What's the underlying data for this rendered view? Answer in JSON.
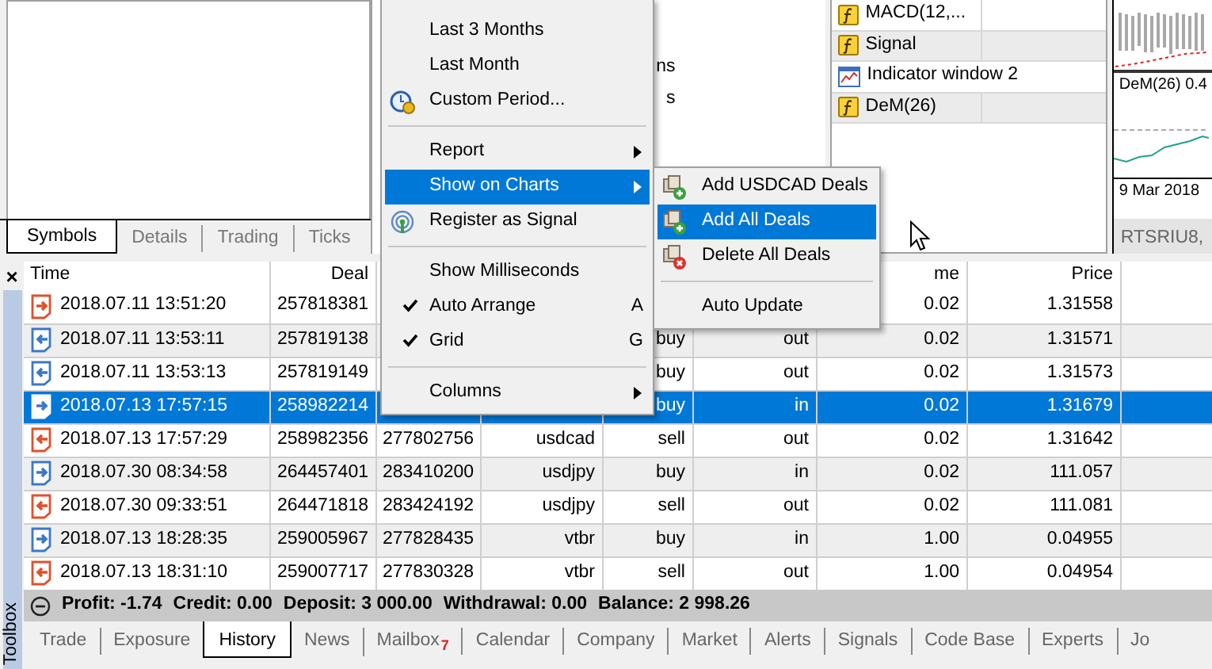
{
  "navigator": {
    "tabs": [
      {
        "label": "Symbols",
        "selected": true
      },
      {
        "label": "Details",
        "selected": false
      },
      {
        "label": "Trading",
        "selected": false
      },
      {
        "label": "Ticks",
        "selected": false
      }
    ]
  },
  "middle_panel": {
    "fragments": [
      "ns",
      "s"
    ]
  },
  "data_window": {
    "rows": [
      {
        "label": "MACD(12,...",
        "kind": "function"
      },
      {
        "label": "Signal",
        "kind": "function"
      },
      {
        "label": "Indicator window 2",
        "kind": "window"
      },
      {
        "label": "DeM(26)",
        "kind": "function"
      }
    ]
  },
  "chart": {
    "subwindow_label": "DeM(26) 0.4",
    "date_label": "9 Mar 2018",
    "tab": "RTSRIU8,"
  },
  "toolbox": {
    "title": "Toolbox",
    "close": "×",
    "columns": [
      "Time",
      "Deal",
      null,
      null,
      null,
      null,
      "me",
      "Price",
      null
    ],
    "rows": [
      {
        "kind": "sell_in",
        "selected": false,
        "cells": [
          "2018.07.11 13:51:20",
          "257818381",
          null,
          null,
          null,
          null,
          "0.02",
          "1.31558"
        ]
      },
      {
        "kind": "buy_out",
        "selected": false,
        "cells": [
          "2018.07.11 13:53:11",
          "257819138",
          null,
          null,
          "buy",
          "out",
          "0.02",
          "1.31571"
        ]
      },
      {
        "kind": "buy_out",
        "selected": false,
        "cells": [
          "2018.07.11 13:53:13",
          "257819149",
          null,
          null,
          "buy",
          "out",
          "0.02",
          "1.31573"
        ]
      },
      {
        "kind": "buy_in",
        "selected": true,
        "cells": [
          "2018.07.13 17:57:15",
          "258982214",
          null,
          null,
          "buy",
          "in",
          "0.02",
          "1.31679"
        ]
      },
      {
        "kind": "sell_out",
        "selected": false,
        "cells": [
          "2018.07.13 17:57:29",
          "258982356",
          "277802756",
          "usdcad",
          "sell",
          "out",
          "0.02",
          "1.31642"
        ]
      },
      {
        "kind": "buy_in",
        "selected": false,
        "cells": [
          "2018.07.30 08:34:58",
          "264457401",
          "283410200",
          "usdjpy",
          "buy",
          "in",
          "0.02",
          "111.057"
        ]
      },
      {
        "kind": "sell_out",
        "selected": false,
        "cells": [
          "2018.07.30 09:33:51",
          "264471818",
          "283424192",
          "usdjpy",
          "sell",
          "out",
          "0.02",
          "111.081"
        ]
      },
      {
        "kind": "buy_in",
        "selected": false,
        "cells": [
          "2018.07.13 18:28:35",
          "259005967",
          "277828435",
          "vtbr",
          "buy",
          "in",
          "1.00",
          "0.04955"
        ]
      },
      {
        "kind": "sell_out",
        "selected": false,
        "cells": [
          "2018.07.13 18:31:10",
          "259007717",
          "277830328",
          "vtbr",
          "sell",
          "out",
          "1.00",
          "0.04954"
        ]
      }
    ],
    "summary": [
      "Profit: -1.74",
      "Credit: 0.00",
      "Deposit: 3 000.00",
      "Withdrawal: 0.00",
      "Balance: 2 998.26"
    ],
    "tabs": [
      {
        "label": "Trade",
        "selected": false
      },
      {
        "label": "Exposure",
        "selected": false
      },
      {
        "label": "History",
        "selected": true
      },
      {
        "label": "News",
        "selected": false
      },
      {
        "label": "Mailbox",
        "selected": false,
        "badge": "7"
      },
      {
        "label": "Calendar",
        "selected": false
      },
      {
        "label": "Company",
        "selected": false
      },
      {
        "label": "Market",
        "selected": false
      },
      {
        "label": "Alerts",
        "selected": false
      },
      {
        "label": "Signals",
        "selected": false
      },
      {
        "label": "Code Base",
        "selected": false
      },
      {
        "label": "Experts",
        "selected": false
      },
      {
        "label": "Jo",
        "selected": false
      }
    ]
  },
  "context_menu": {
    "items": [
      {
        "kind": "item",
        "label": "Last 3 Months",
        "selected": false
      },
      {
        "kind": "item",
        "label": "Last Month",
        "selected": false
      },
      {
        "kind": "clock_item",
        "label": "Custom Period...",
        "selected": false
      },
      {
        "kind": "separator"
      },
      {
        "kind": "item",
        "label": "Report",
        "selected": false,
        "has_submenu": true
      },
      {
        "kind": "item",
        "label": "Show on Charts",
        "selected": true,
        "has_submenu": true
      },
      {
        "kind": "signal_item",
        "label": "Register as Signal",
        "selected": false
      },
      {
        "kind": "separator"
      },
      {
        "kind": "item",
        "label": "Show Milliseconds",
        "selected": false,
        "checked": false
      },
      {
        "kind": "item",
        "label": "Auto Arrange",
        "selected": false,
        "checked": true,
        "shortcut": "A"
      },
      {
        "kind": "item",
        "label": "Grid",
        "selected": false,
        "checked": true,
        "shortcut": "G"
      },
      {
        "kind": "separator"
      },
      {
        "kind": "item",
        "label": "Columns",
        "selected": false,
        "has_submenu": true
      }
    ]
  },
  "submenu": {
    "items": [
      {
        "kind": "add_item",
        "label": "Add USDCAD Deals",
        "selected": false
      },
      {
        "kind": "add_item",
        "label": "Add All Deals",
        "selected": true
      },
      {
        "kind": "delete_item",
        "label": "Delete All Deals",
        "selected": false
      },
      {
        "kind": "separator"
      },
      {
        "kind": "item",
        "label": "Auto Update",
        "selected": false
      }
    ]
  }
}
